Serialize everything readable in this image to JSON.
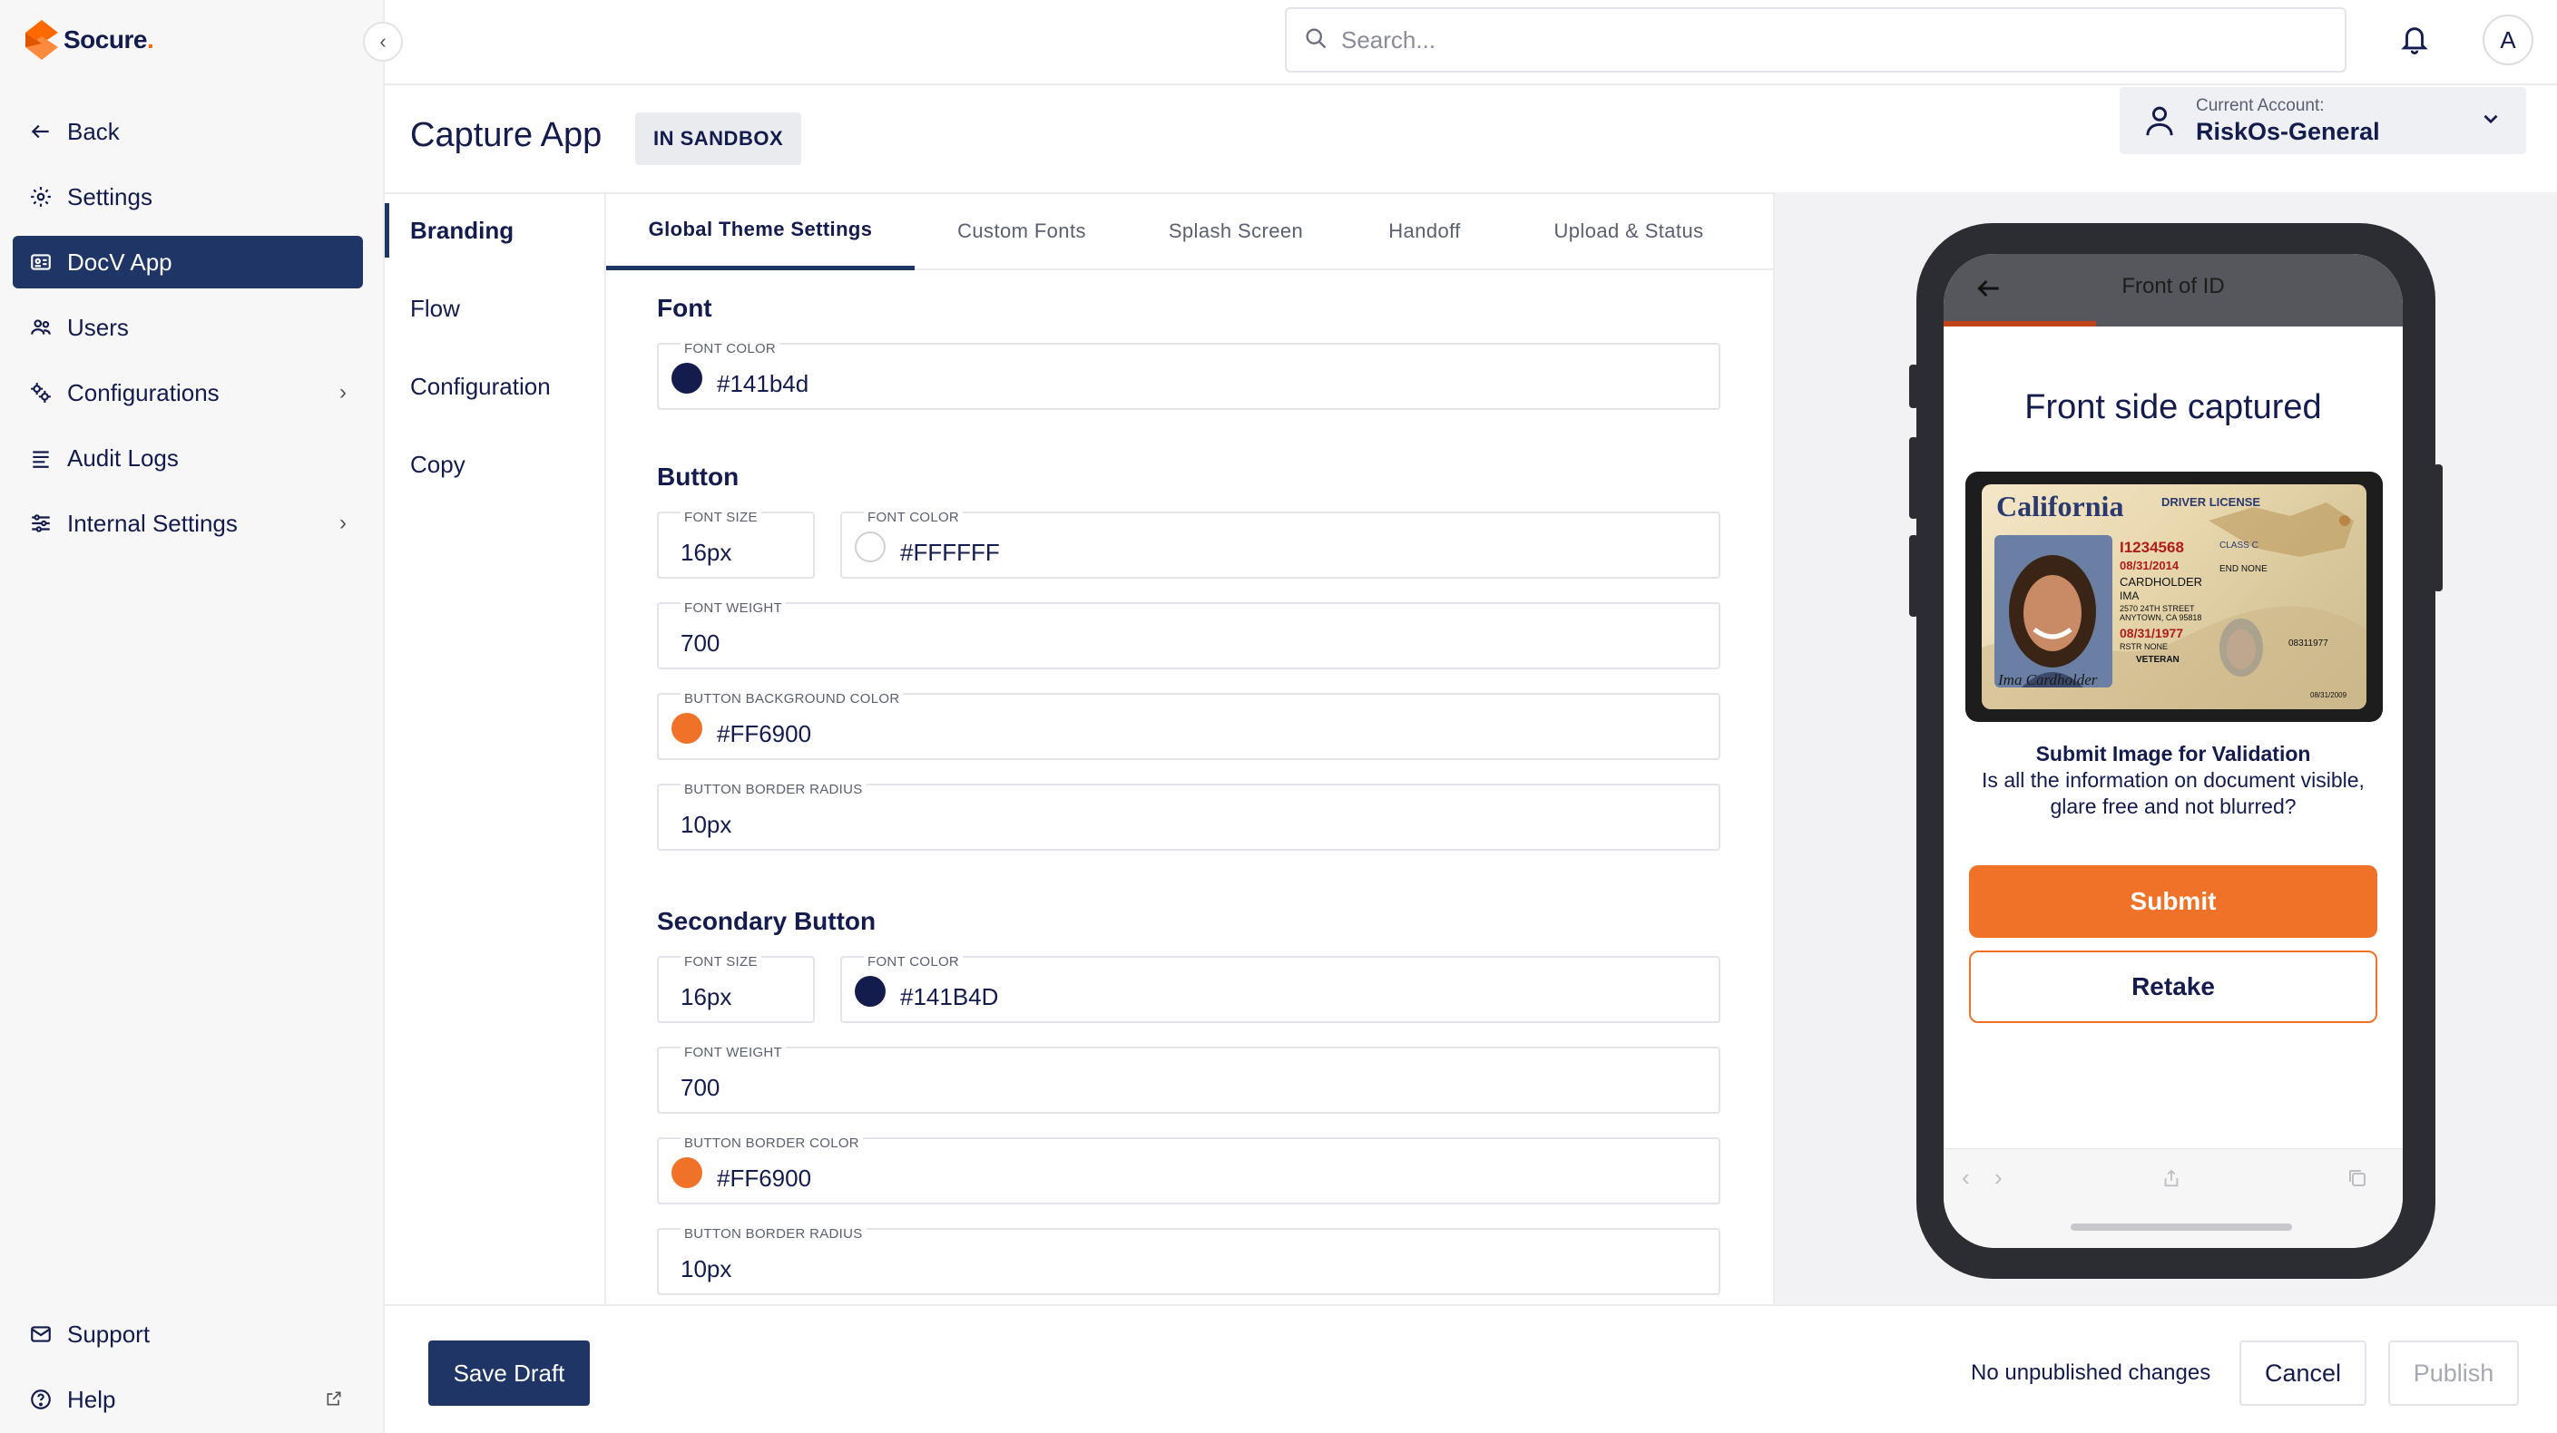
{
  "brand": {
    "name": "Socure",
    "accent": "#ff6900",
    "navy": "#1f3566"
  },
  "search": {
    "placeholder": "Search..."
  },
  "user": {
    "avatar_initial": "A"
  },
  "sidebar": {
    "items": [
      {
        "label": "Back",
        "icon": "arrow-left-icon"
      },
      {
        "label": "Settings",
        "icon": "gear-icon"
      },
      {
        "label": "DocV App",
        "icon": "id-card-icon",
        "active": true
      },
      {
        "label": "Users",
        "icon": "users-icon"
      },
      {
        "label": "Configurations",
        "icon": "configurations-icon"
      },
      {
        "label": "Audit Logs",
        "icon": "list-icon"
      },
      {
        "label": "Internal Settings",
        "icon": "sliders-icon"
      }
    ],
    "bottom_items": [
      {
        "label": "Support",
        "icon": "mail-icon"
      },
      {
        "label": "Help",
        "icon": "help-circle-icon"
      }
    ]
  },
  "header": {
    "title": "Capture App",
    "badge": "IN SANDBOX",
    "account_label": "Current Account:",
    "account_name": "RiskOs-General"
  },
  "left_tabs": [
    "Branding",
    "Flow",
    "Configuration",
    "Copy"
  ],
  "top_tabs": [
    "Global Theme Settings",
    "Custom Fonts",
    "Splash Screen",
    "Handoff",
    "Upload & Status"
  ],
  "form": {
    "font": {
      "title": "Font",
      "font_color_label": "FONT COLOR",
      "font_color": "#141b4d"
    },
    "button": {
      "title": "Button",
      "font_size_label": "FONT SIZE",
      "font_size": "16px",
      "font_color_label": "FONT COLOR",
      "font_color": "#FFFFFF",
      "font_weight_label": "FONT WEIGHT",
      "font_weight": "700",
      "bg_color_label": "BUTTON BACKGROUND COLOR",
      "bg_color": "#FF6900",
      "radius_label": "BUTTON BORDER RADIUS",
      "radius": "10px"
    },
    "secondary_button": {
      "title": "Secondary Button",
      "font_size_label": "FONT SIZE",
      "font_size": "16px",
      "font_color_label": "FONT COLOR",
      "font_color": "#141B4D",
      "font_weight_label": "FONT WEIGHT",
      "font_weight": "700",
      "border_color_label": "BUTTON BORDER COLOR",
      "border_color": "#FF6900",
      "radius_label": "BUTTON BORDER RADIUS",
      "radius": "10px"
    }
  },
  "preview": {
    "header_title": "Front of ID",
    "modal_title": "Front side captured",
    "id_card": {
      "state": "California",
      "type": "DRIVER LICENSE",
      "dl": "I1234568",
      "exp": "08/31/2014",
      "ln": "CARDHOLDER",
      "fn": "IMA",
      "address1": "2570 24TH STREET",
      "address2": "ANYTOWN, CA 95818",
      "dob": "08/31/1977",
      "class": "CLASS C",
      "end": "END NONE",
      "rstr": "RSTR NONE",
      "veteran": "VETERAN",
      "signature": "Ima Cardholder",
      "doc_number": "08311977",
      "issued": "08/31/2009"
    },
    "submit_title": "Submit Image for Validation",
    "submit_desc": "Is all the information on document visible, glare free and not blurred?",
    "submit_label": "Submit",
    "retake_label": "Retake"
  },
  "footer": {
    "save_label": "Save Draft",
    "status": "No unpublished changes",
    "cancel_label": "Cancel",
    "publish_label": "Publish"
  }
}
